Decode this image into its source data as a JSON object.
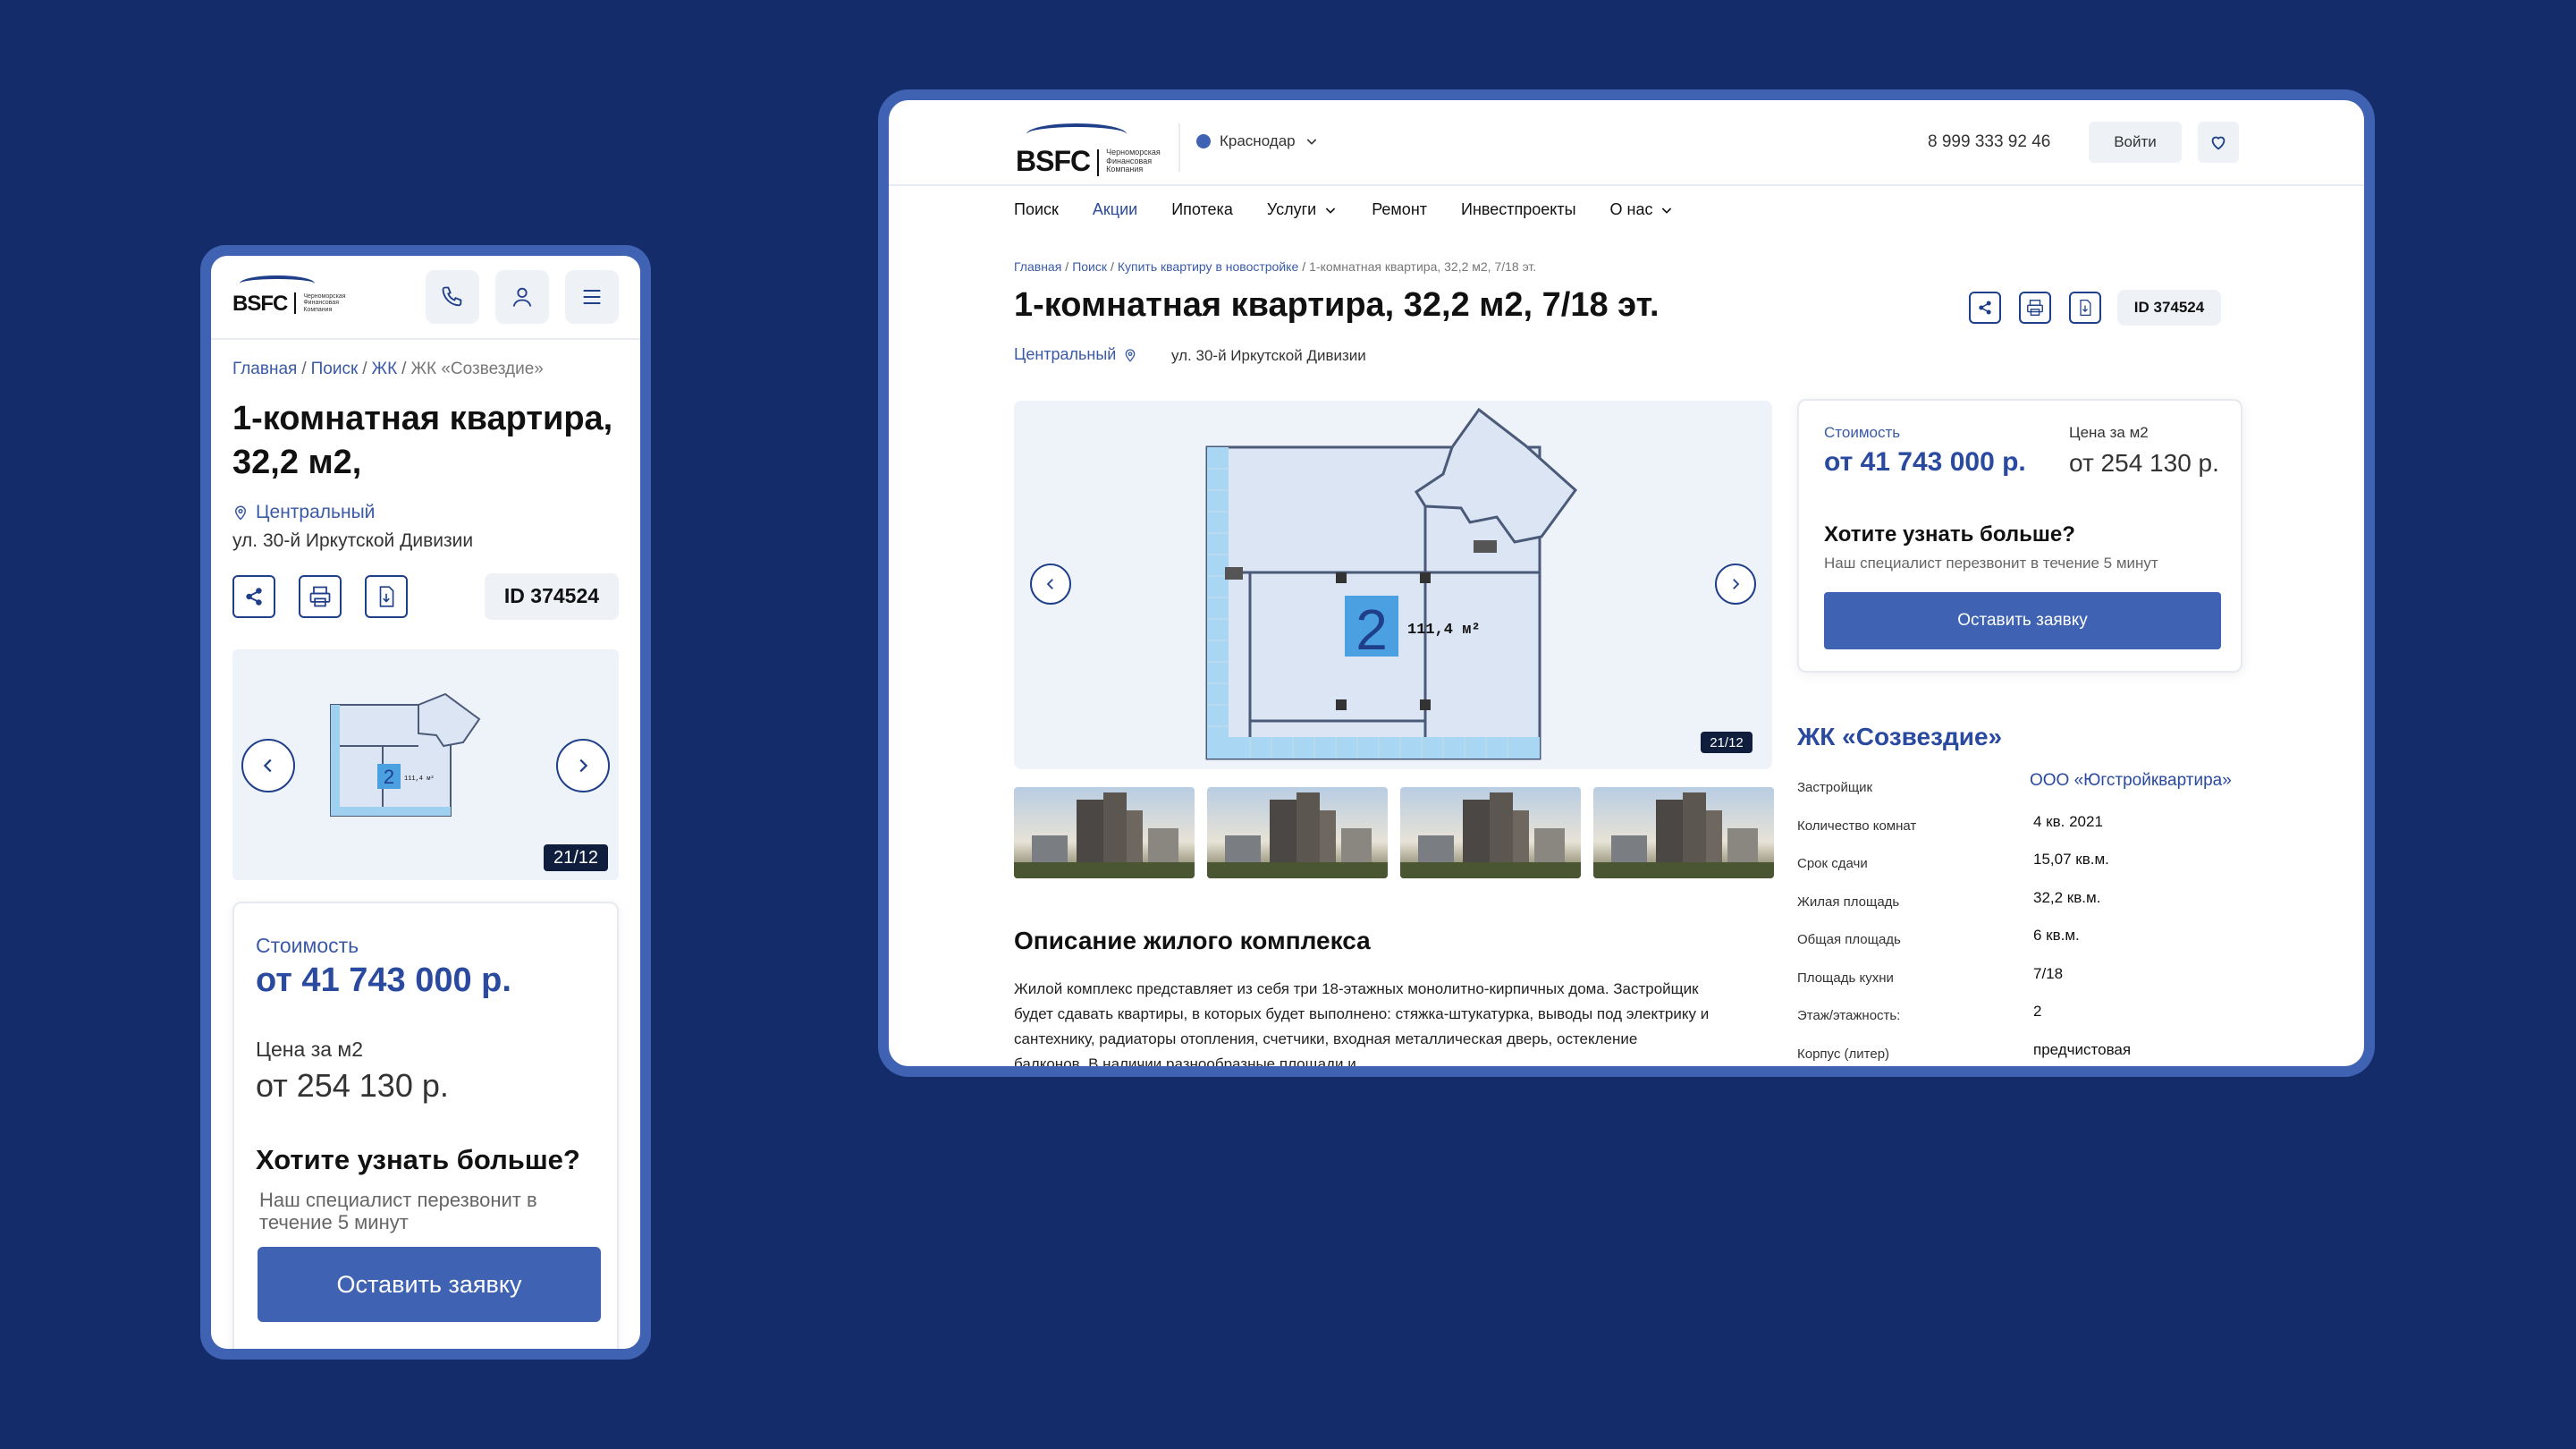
{
  "brand": {
    "logo_text": "BSFC",
    "logo_subtitle": "Черноморская Финансовая Компания"
  },
  "colors": {
    "background": "#142d6a",
    "frame": "#3f62b3",
    "accent": "#2a4aa0",
    "button": "#3f62b3"
  },
  "mobile": {
    "header_icons": [
      "phone-icon",
      "user-icon",
      "menu-icon"
    ],
    "breadcrumbs": [
      "Главная",
      "Поиск",
      "ЖК"
    ],
    "breadcrumb_current": "ЖК «Созвездие»",
    "title": "1-комнатная квартира, 32,2 м2,",
    "district": "Центральный",
    "address": "ул. 30-й Иркутской Дивизии",
    "id_label": "ID 374524",
    "gallery_counter": "21/12",
    "card": {
      "cost_label": "Стоимость",
      "cost_value": "от 41 743 000 р.",
      "per_m2_label": "Цена за м2",
      "per_m2_value": "от 254 130 р.",
      "question": "Хотите узнать больше?",
      "subtitle": "Наш специалист перезвонит в течение 5 минут",
      "cta": "Оставить заявку"
    }
  },
  "desktop": {
    "city": "Краснодар",
    "phone": "8 999 333 92 46",
    "login": "Войти",
    "nav": [
      {
        "label": "Поиск"
      },
      {
        "label": "Акции"
      },
      {
        "label": "Ипотека"
      },
      {
        "label": "Услуги"
      },
      {
        "label": "Ремонт"
      },
      {
        "label": "Инвестпроекты"
      },
      {
        "label": "О нас"
      }
    ],
    "breadcrumbs": [
      "Главная",
      "Поиск",
      "Купить квартиру в новостройке"
    ],
    "breadcrumb_current": "1-комнатная квартира, 32,2 м2, 7/18 эт.",
    "title": "1-комнатная квартира, 32,2 м2, 7/18 эт.",
    "district": "Центральный",
    "address": "ул. 30-й Иркутской Дивизии",
    "id_label": "ID 374524",
    "gallery_counter": "21/12",
    "plan": {
      "room_number": "2",
      "area": "111,4 м²"
    },
    "card": {
      "cost_label": "Стоимость",
      "cost_value": "от 41 743 000 р.",
      "per_m2_label": "Цена за м2",
      "per_m2_value": "от 254 130 р.",
      "question": "Хотите узнать больше?",
      "subtitle": "Наш специалист перезвонит в течение 5 минут",
      "cta": "Оставить заявку"
    },
    "complex_title": "ЖК «Созвездие»",
    "specs": [
      {
        "key": "Застройщик",
        "value": "ООО «Югстройквартира»"
      },
      {
        "key": "Количество комнат",
        "value": "4 кв. 2021"
      },
      {
        "key": "Срок сдачи",
        "value": "15,07 кв.м."
      },
      {
        "key": "Жилая площадь",
        "value": "32,2 кв.м."
      },
      {
        "key": "Общая площадь",
        "value": "6 кв.м."
      },
      {
        "key": "Площадь кухни",
        "value": "7/18"
      },
      {
        "key": "Этаж/этажность:",
        "value": "2"
      },
      {
        "key": "Корпус (литер)",
        "value": "предчистовая"
      }
    ],
    "description_title": "Описание жилого комплекса",
    "description": "Жилой комплекс представляет из себя три 18-этажных монолитно-кирпичных дома. Застройщик будет сдавать квартиры, в которых будет выполнено: стяжка-штукатурка, выводы под электрику и сантехнику, радиаторы отопления, счетчики, входная металлическая дверь, остекление балконов. В наличии разнообразные площади и"
  }
}
